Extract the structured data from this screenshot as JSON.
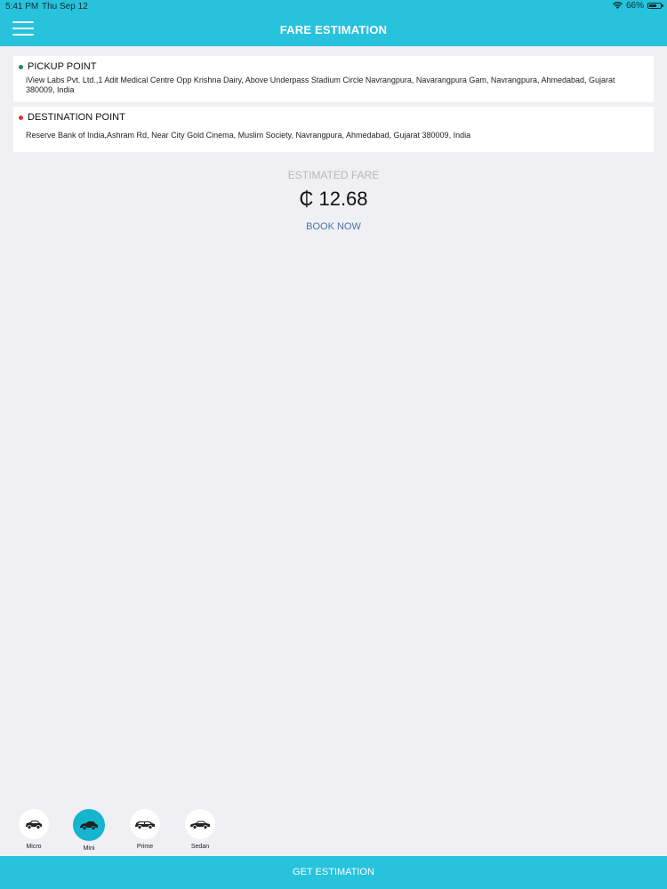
{
  "status_bar": {
    "time": "5:41 PM",
    "date": "Thu Sep 12",
    "battery": "66%",
    "battery_level": 0.66
  },
  "header": {
    "title": "FARE ESTIMATION",
    "menu_icon": "hamburger-menu-icon"
  },
  "pickup": {
    "title": "PICKUP POINT",
    "address": "iView Labs Pvt. Ltd.,1 Adit Medical Centre Opp Krishna Dairy, Above Underpass Stadium Circle Navrangpura, Navarangpura Gam, Navrangpura, Ahmedabad, Gujarat 380009, India",
    "dot_color": "#1e8a4a"
  },
  "destination": {
    "title": "DESTINATION POINT",
    "address": "Reserve Bank of India,Ashram Rd, Near City Gold Cinema, Muslim Society, Navrangpura, Ahmedabad, Gujarat 380009, India",
    "dot_color": "#e0332c"
  },
  "fare": {
    "label": "ESTIMATED FARE",
    "value": "₵ 12.68",
    "book_label": "BOOK NOW"
  },
  "vehicles": [
    {
      "label": "Micro",
      "icon": "car-icon",
      "selected": false
    },
    {
      "label": "Mini",
      "icon": "car-icon",
      "selected": true
    },
    {
      "label": "Prime",
      "icon": "car-icon",
      "selected": false
    },
    {
      "label": "Sedan",
      "icon": "car-icon",
      "selected": false
    }
  ],
  "bottom": {
    "button_label": "GET ESTIMATION"
  },
  "colors": {
    "accent": "#27c2dc",
    "selected_vehicle": "#15b4cf",
    "background": "#efeff4",
    "link": "#4a72a8"
  }
}
